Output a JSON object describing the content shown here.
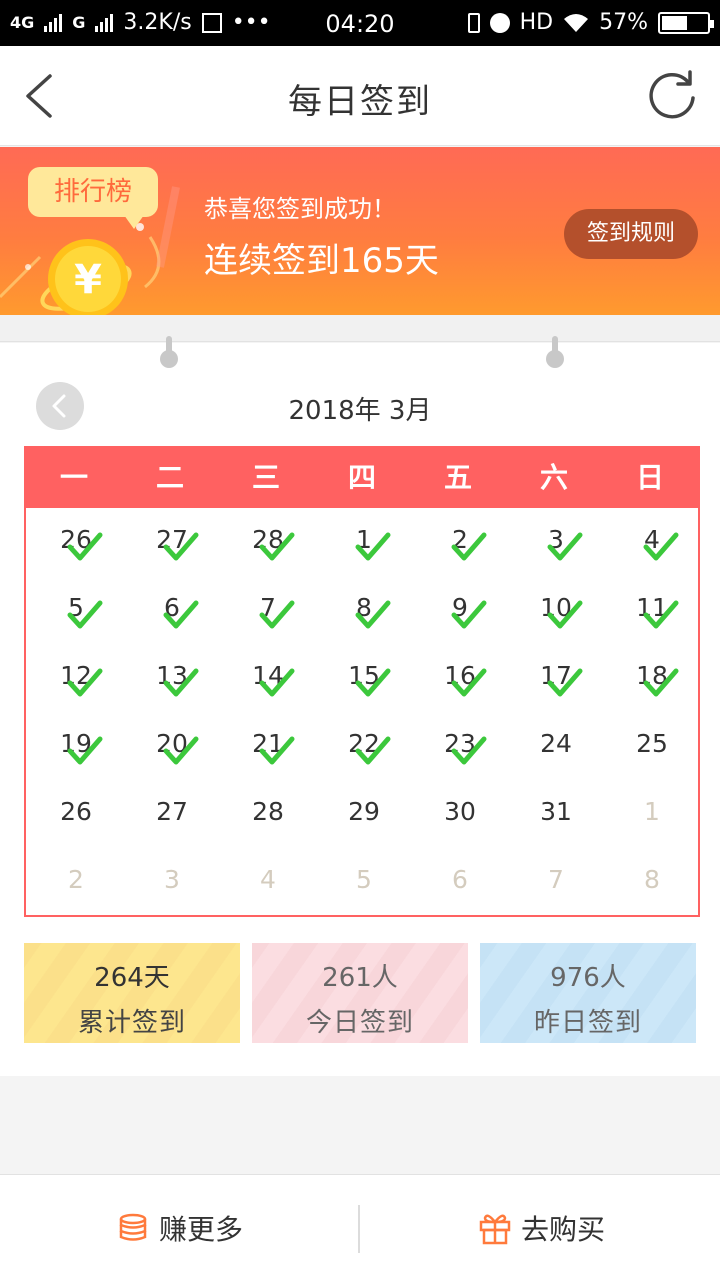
{
  "status_bar": {
    "network_left": "4G",
    "network_right": "G",
    "speed": "3.2K/s",
    "more": "•••",
    "time": "04:20",
    "hd": "HD",
    "battery_text": "57%",
    "battery_level": 0.57
  },
  "header": {
    "title": "每日签到",
    "back_icon": "chevron-left-icon",
    "refresh_icon": "refresh-icon"
  },
  "banner": {
    "rank_label": "排行榜",
    "coin_symbol": "¥",
    "congrats": "恭喜您签到成功！",
    "streak": "连续签到165天",
    "rules_button": "签到规则"
  },
  "calendar": {
    "month_title": "2018年 3月",
    "weekdays": [
      "一",
      "二",
      "三",
      "四",
      "五",
      "六",
      "日"
    ],
    "weeks": [
      [
        {
          "d": "26",
          "c": true,
          "o": false
        },
        {
          "d": "27",
          "c": true,
          "o": false
        },
        {
          "d": "28",
          "c": true,
          "o": false
        },
        {
          "d": "1",
          "c": true,
          "o": false
        },
        {
          "d": "2",
          "c": true,
          "o": false
        },
        {
          "d": "3",
          "c": true,
          "o": false
        },
        {
          "d": "4",
          "c": true,
          "o": false
        }
      ],
      [
        {
          "d": "5",
          "c": true,
          "o": false
        },
        {
          "d": "6",
          "c": true,
          "o": false
        },
        {
          "d": "7",
          "c": true,
          "o": false
        },
        {
          "d": "8",
          "c": true,
          "o": false
        },
        {
          "d": "9",
          "c": true,
          "o": false
        },
        {
          "d": "10",
          "c": true,
          "o": false
        },
        {
          "d": "11",
          "c": true,
          "o": false
        }
      ],
      [
        {
          "d": "12",
          "c": true,
          "o": false
        },
        {
          "d": "13",
          "c": true,
          "o": false
        },
        {
          "d": "14",
          "c": true,
          "o": false
        },
        {
          "d": "15",
          "c": true,
          "o": false
        },
        {
          "d": "16",
          "c": true,
          "o": false
        },
        {
          "d": "17",
          "c": true,
          "o": false
        },
        {
          "d": "18",
          "c": true,
          "o": false
        }
      ],
      [
        {
          "d": "19",
          "c": true,
          "o": false
        },
        {
          "d": "20",
          "c": true,
          "o": false
        },
        {
          "d": "21",
          "c": true,
          "o": false
        },
        {
          "d": "22",
          "c": true,
          "o": false
        },
        {
          "d": "23",
          "c": true,
          "o": false
        },
        {
          "d": "24",
          "c": false,
          "o": false
        },
        {
          "d": "25",
          "c": false,
          "o": false
        }
      ],
      [
        {
          "d": "26",
          "c": false,
          "o": false
        },
        {
          "d": "27",
          "c": false,
          "o": false
        },
        {
          "d": "28",
          "c": false,
          "o": false
        },
        {
          "d": "29",
          "c": false,
          "o": false
        },
        {
          "d": "30",
          "c": false,
          "o": false
        },
        {
          "d": "31",
          "c": false,
          "o": false
        },
        {
          "d": "1",
          "c": false,
          "o": true
        }
      ],
      [
        {
          "d": "2",
          "c": false,
          "o": true
        },
        {
          "d": "3",
          "c": false,
          "o": true
        },
        {
          "d": "4",
          "c": false,
          "o": true
        },
        {
          "d": "5",
          "c": false,
          "o": true
        },
        {
          "d": "6",
          "c": false,
          "o": true
        },
        {
          "d": "7",
          "c": false,
          "o": true
        },
        {
          "d": "8",
          "c": false,
          "o": true
        }
      ]
    ]
  },
  "stats": {
    "total": {
      "value": "264天",
      "label": "累计签到"
    },
    "today": {
      "value": "261人",
      "label": "今日签到"
    },
    "yesterday": {
      "value": "976人",
      "label": "昨日签到"
    }
  },
  "bottom_bar": {
    "earn_more": "赚更多",
    "buy": "去购买",
    "earn_icon": "coins-icon",
    "buy_icon": "gift-icon"
  },
  "colors": {
    "accent_red": "#ff6161",
    "check_green": "#3cc83c",
    "banner_orange": "#ff7d40",
    "bottom_icon_orange": "#ff7a3c"
  }
}
